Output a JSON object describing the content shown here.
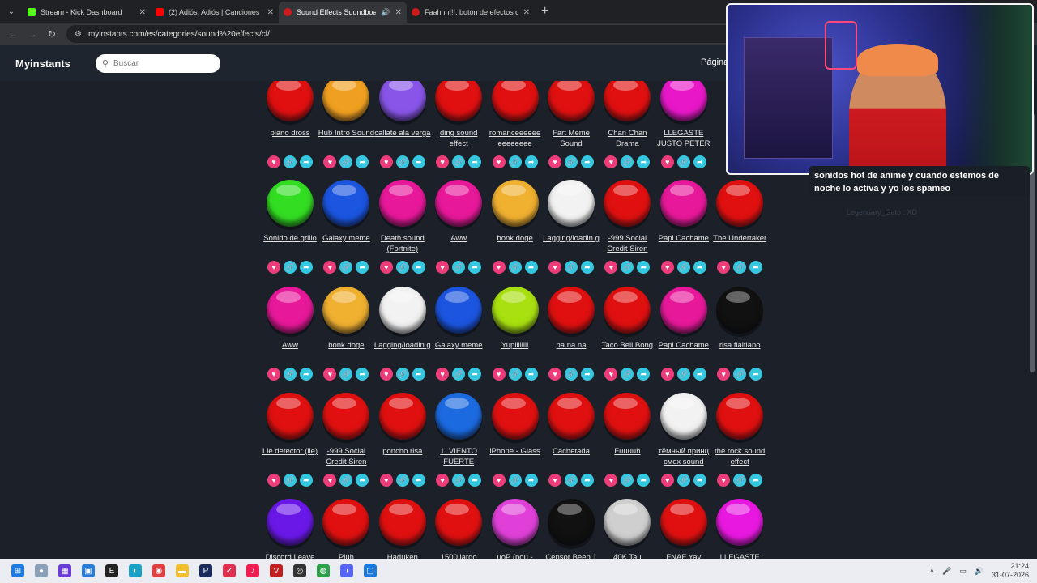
{
  "browser": {
    "tabs": [
      {
        "title": "Stream - Kick Dashboard",
        "color": "#53fc18",
        "active": false,
        "audio": false
      },
      {
        "title": "(2) Adiós, Adiós | Canciones Infa",
        "color": "#ff0000",
        "active": false,
        "audio": false
      },
      {
        "title": "Sound Effects Soundboard",
        "color": "#cc1b1b",
        "active": true,
        "audio": true
      },
      {
        "title": "Faahhh!!!: botón de efectos de",
        "color": "#cc1b1b",
        "active": false,
        "audio": false
      }
    ],
    "url": "myinstants.com/es/categories/sound%20effects/cl/"
  },
  "site": {
    "logo": "Myinstants",
    "search_placeholder": "Buscar",
    "header_right": "Página"
  },
  "sounds": [
    {
      "label": "piano dross",
      "color": "#e01010"
    },
    {
      "label": "Hub Intro Sound",
      "color": "#f0a020"
    },
    {
      "label": "callate ala verga",
      "color": "#8855e8"
    },
    {
      "label": "ding sound effect",
      "color": "#e01010"
    },
    {
      "label": "romanceeeeee eeeeeeee",
      "color": "#e01010"
    },
    {
      "label": "Fart Meme Sound",
      "color": "#e01010"
    },
    {
      "label": "Chan Chan Drama",
      "color": "#e01010"
    },
    {
      "label": "LLEGASTE JUSTO PETER",
      "color": "#e818c8"
    },
    {
      "label": "Sonido de grillo",
      "color": "#33dd22"
    },
    {
      "label": "Galaxy meme",
      "color": "#1b55e0"
    },
    {
      "label": "Death sound (Fortnite)",
      "color": "#e8189a"
    },
    {
      "label": "Aww",
      "color": "#e8189a"
    },
    {
      "label": "bonk doge",
      "color": "#f0b030"
    },
    {
      "label": "Lagging/loadin g",
      "color": "#f2f2f2"
    },
    {
      "label": "-999 Social Credit Siren",
      "color": "#e01010"
    },
    {
      "label": "Papi Cachame",
      "color": "#e8189a"
    },
    {
      "label": "The Undertaker",
      "color": "#e01010"
    },
    {
      "label": "Aww",
      "color": "#e8189a"
    },
    {
      "label": "bonk doge",
      "color": "#f0b030"
    },
    {
      "label": "Lagging/loadin g",
      "color": "#f2f2f2"
    },
    {
      "label": "Galaxy meme",
      "color": "#1b55e0"
    },
    {
      "label": "Yupiiiiiiii",
      "color": "#a8e010"
    },
    {
      "label": "na na na",
      "color": "#e01010"
    },
    {
      "label": "Taco Bell Bong",
      "color": "#e01010"
    },
    {
      "label": "Papi Cachame",
      "color": "#e8189a"
    },
    {
      "label": "risa flaitiano",
      "color": "#111111"
    },
    {
      "label": "Lie detector (lie)",
      "color": "#e01010"
    },
    {
      "label": "-999 Social Credit Siren",
      "color": "#e01010"
    },
    {
      "label": "poncho risa",
      "color": "#e01010"
    },
    {
      "label": "1. VIENTO FUERTE",
      "color": "#1b6ae0"
    },
    {
      "label": "iPhone - Glass",
      "color": "#e01010"
    },
    {
      "label": "Cachetada",
      "color": "#e01010"
    },
    {
      "label": "Fuuuuh",
      "color": "#e01010"
    },
    {
      "label": "тёмный принц смех sound",
      "color": "#f2f2f2"
    },
    {
      "label": "the rock sound effect",
      "color": "#e01010"
    },
    {
      "label": "Discord Leave",
      "color": "#6a18e8"
    },
    {
      "label": "Pluh",
      "color": "#e01010"
    },
    {
      "label": "Haduken",
      "color": "#e01010"
    },
    {
      "label": "1500 largo",
      "color": "#e01010"
    },
    {
      "label": "uoP (pou -",
      "color": "#e040d8"
    },
    {
      "label": "Censor Beep 1",
      "color": "#111111"
    },
    {
      "label": "40K Tau",
      "color": "#cfcfcf"
    },
    {
      "label": "FNAF Yay",
      "color": "#e01010"
    },
    {
      "label": "LLEGASTE",
      "color": "#e818e0"
    }
  ],
  "stream_overlay": {
    "chat_message": "sonidos hot de anime y cuando estemos de noche lo activa y yo los spameo",
    "chat_user": "Legendary_Gato : XD"
  },
  "taskbar": {
    "time": "21:24",
    "date": "31-07-2026"
  }
}
